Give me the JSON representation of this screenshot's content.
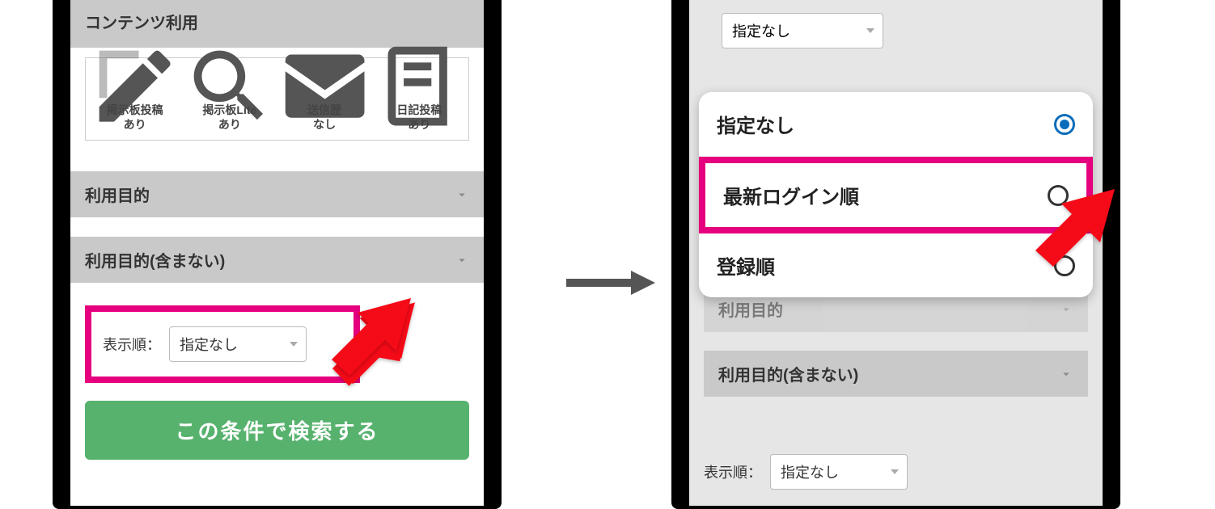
{
  "left": {
    "content_usage_header": "コンテンツ利用",
    "content_usage_items": [
      {
        "label": "掲示板投稿\nあり"
      },
      {
        "label": "掲示板Lite\nあり"
      },
      {
        "label": "送信歴\nなし"
      },
      {
        "label": "日記投稿\nあり"
      }
    ],
    "purpose_header": "利用目的",
    "purpose_exclude_header": "利用目的(含まない)",
    "display_order_label": "表示順：",
    "display_order_value": "指定なし",
    "search_button": "この条件で検索する"
  },
  "right": {
    "top_select_value": "指定なし",
    "popup_options": [
      {
        "label": "指定なし",
        "selected": true
      },
      {
        "label": "最新ログイン順",
        "selected": false,
        "highlighted": true
      },
      {
        "label": "登録順",
        "selected": false
      }
    ],
    "purpose_header": "利用目的",
    "purpose_exclude_header": "利用目的(含まない)",
    "display_order_label": "表示順：",
    "display_order_value": "指定なし"
  }
}
